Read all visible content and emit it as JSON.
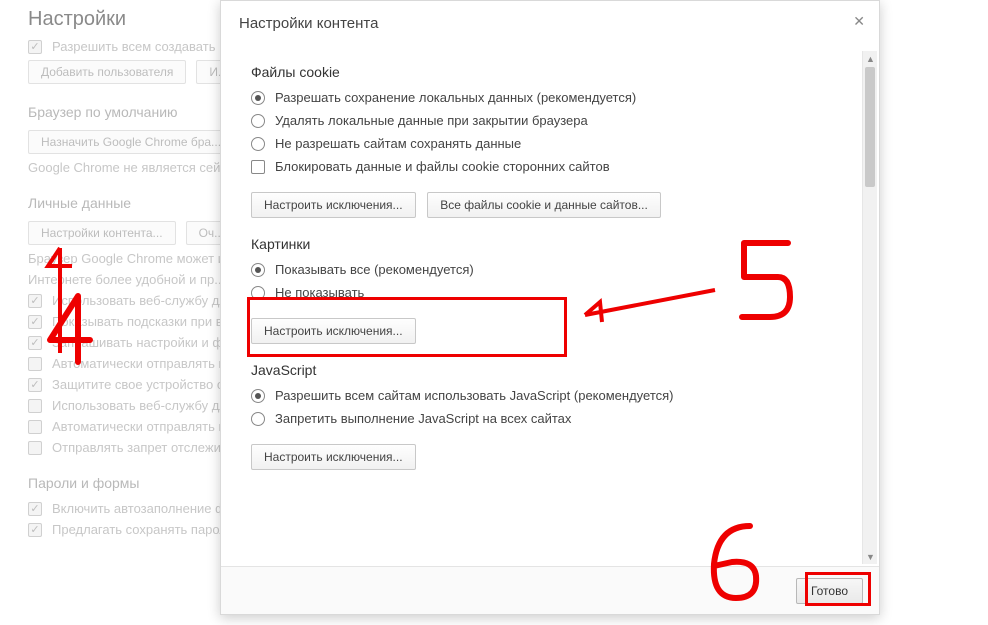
{
  "bg": {
    "title": "Настройки",
    "users": {
      "allow_all": "Разрешить всем создавать п...",
      "add_user": "Добавить пользователя",
      "and": "И..."
    },
    "default_browser": {
      "title": "Браузер по умолчанию",
      "set_btn": "Назначить Google Chrome бра...",
      "not_default": "Google Chrome не является сей..."
    },
    "privacy": {
      "title": "Личные данные",
      "content_btn": "Настройки контента...",
      "clear_btn": "Оч...",
      "line1": "Браузер Google Chrome может и...",
      "line2": "Интернете более удобной и пр...",
      "opts": [
        "Использовать веб-службу дл...",
        "Показывать подсказки при в...",
        "Запрашивать настройки и фа...",
        "Автоматически отправлять в...",
        "Защитите свое устройство о...",
        "Использовать веб-службу дл...",
        "Автоматически отправлять в...",
        "Отправлять запрет отслежи..."
      ]
    },
    "passwords": {
      "title": "Пароли и формы",
      "opt1": "Включить автозаполнение ф...",
      "opt2": "Предлагать сохранять пароли для сайтов Настроить"
    }
  },
  "modal": {
    "title": "Настройки контента",
    "cookies": {
      "heading": "Файлы cookie",
      "opts": [
        "Разрешать сохранение локальных данных (рекомендуется)",
        "Удалять локальные данные при закрытии браузера",
        "Не разрешать сайтам сохранять данные"
      ],
      "block_third": "Блокировать данные и файлы cookie сторонних сайтов",
      "exceptions_btn": "Настроить исключения...",
      "all_cookies_btn": "Все файлы cookie и данные сайтов..."
    },
    "images": {
      "heading": "Картинки",
      "show_all": "Показывать все (рекомендуется)",
      "dont_show": "Не показывать",
      "exceptions_btn": "Настроить исключения..."
    },
    "js": {
      "heading": "JavaScript",
      "allow": "Разрешить всем сайтам использовать JavaScript (рекомендуется)",
      "block": "Запретить выполнение JavaScript на всех сайтах",
      "exceptions_btn": "Настроить исключения..."
    },
    "done": "Готово"
  },
  "annotations": {
    "five": "5",
    "six": "6",
    "four": "4"
  }
}
